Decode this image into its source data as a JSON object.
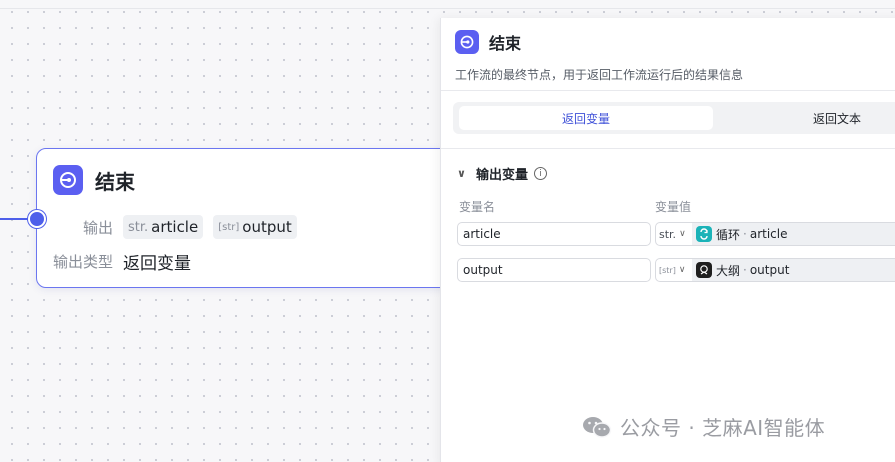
{
  "node": {
    "title": "结束",
    "output_label": "输出",
    "outputs": [
      {
        "prefix": "str.",
        "name": "article"
      },
      {
        "prefix": "[str]",
        "name": "output"
      }
    ],
    "output_type_label": "输出类型",
    "output_type_value": "返回变量"
  },
  "panel": {
    "title": "结束",
    "description": "工作流的最终节点，用于返回工作流运行后的结果信息",
    "tabs": [
      {
        "label": "返回变量",
        "active": true
      },
      {
        "label": "返回文本",
        "active": false
      }
    ],
    "section_title": "输出变量",
    "col_name": "变量名",
    "col_value": "变量值",
    "rows": [
      {
        "name": "article",
        "type": "str.",
        "source": "循环",
        "field": "article",
        "icon": "loop-icon"
      },
      {
        "name": "output",
        "type": "[str]",
        "source": "大纲",
        "field": "output",
        "icon": "outline-icon"
      }
    ]
  },
  "watermark": {
    "text": "公众号 · 芝麻AI智能体"
  },
  "colors": {
    "accent": "#5b5ff1",
    "node_border": "#6b76f0",
    "teal": "#1bb3b8"
  }
}
